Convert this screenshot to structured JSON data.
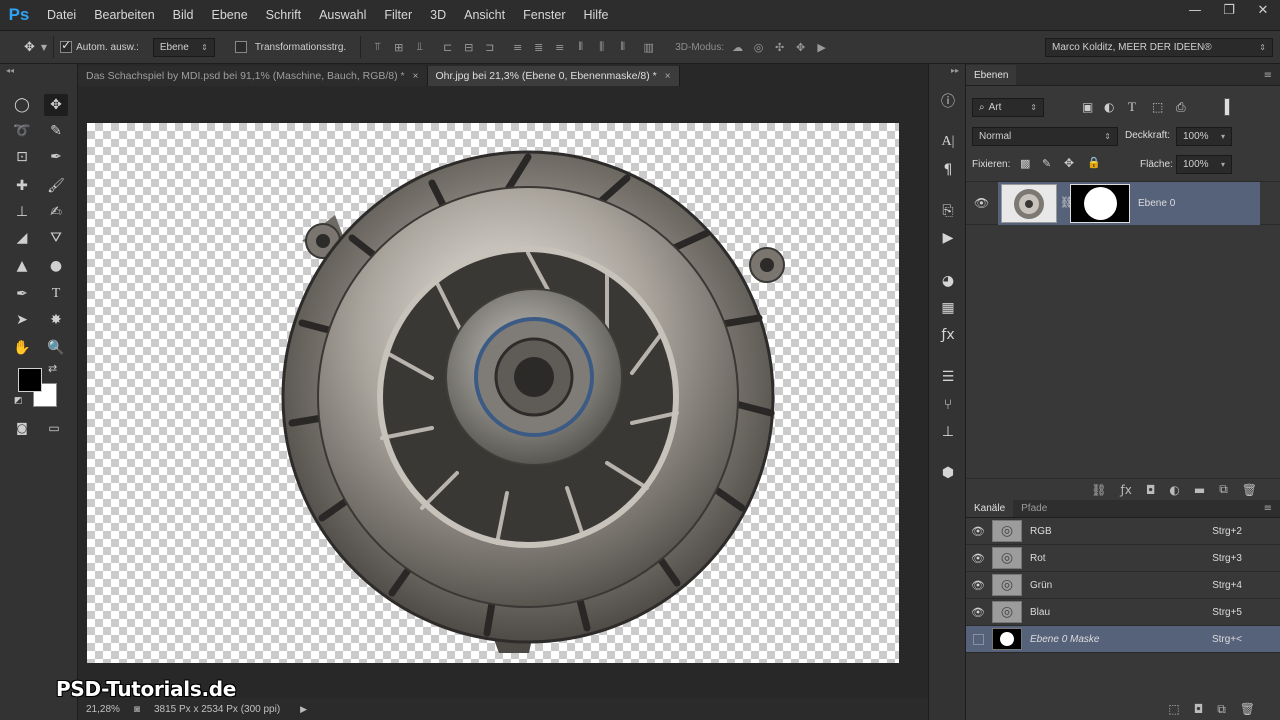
{
  "app": {
    "logo": "Ps"
  },
  "menu": [
    "Datei",
    "Bearbeiten",
    "Bild",
    "Ebene",
    "Schrift",
    "Auswahl",
    "Filter",
    "3D",
    "Ansicht",
    "Fenster",
    "Hilfe"
  ],
  "window_controls": {
    "minimize": "—",
    "restore": "❐",
    "close": "✕"
  },
  "options": {
    "auto_select_label": "Autom. ausw.:",
    "auto_select_checked": true,
    "auto_select_target": "Ebene",
    "transform_label": "Transformationsstrg.",
    "transform_checked": false,
    "mode_3d_label": "3D-Modus:",
    "workspace": "Marco Kolditz, MEER DER IDEEN®"
  },
  "tabs": [
    {
      "label": "Das Schachspiel by MDI.psd bei 91,1% (Maschine, Bauch, RGB/8) *",
      "active": false
    },
    {
      "label": "Ohr.jpg bei 21,3% (Ebene 0, Ebenenmaske/8) *",
      "active": true
    }
  ],
  "tab_close": "×",
  "status": {
    "zoom": "21,28%",
    "dimensions": "3815 Px x 2534 Px (300 ppi)"
  },
  "watermark": "PSD-Tutorials.de",
  "layers_panel": {
    "tab_label": "Ebenen",
    "filter_kind": "Art",
    "blend_mode": "Normal",
    "opacity_label": "Deckkraft:",
    "opacity_value": "100%",
    "lock_label": "Fixieren:",
    "fill_label": "Fläche:",
    "fill_value": "100%",
    "layers": [
      {
        "name": "Ebene 0",
        "visible": true,
        "selected": true
      }
    ]
  },
  "channels_panel": {
    "tabs": [
      "Kanäle",
      "Pfade"
    ],
    "channels": [
      {
        "name": "RGB",
        "shortcut": "Strg+2",
        "visible": true
      },
      {
        "name": "Rot",
        "shortcut": "Strg+3",
        "visible": true
      },
      {
        "name": "Grün",
        "shortcut": "Strg+4",
        "visible": true
      },
      {
        "name": "Blau",
        "shortcut": "Strg+5",
        "visible": true
      },
      {
        "name": "Ebene 0 Maske",
        "shortcut": "Strg+<",
        "visible": false,
        "selected": true
      }
    ]
  },
  "colors": {
    "foreground": "#000000",
    "background": "#ffffff",
    "selection": "#56617a",
    "ps_blue": "#2fa3f7"
  }
}
